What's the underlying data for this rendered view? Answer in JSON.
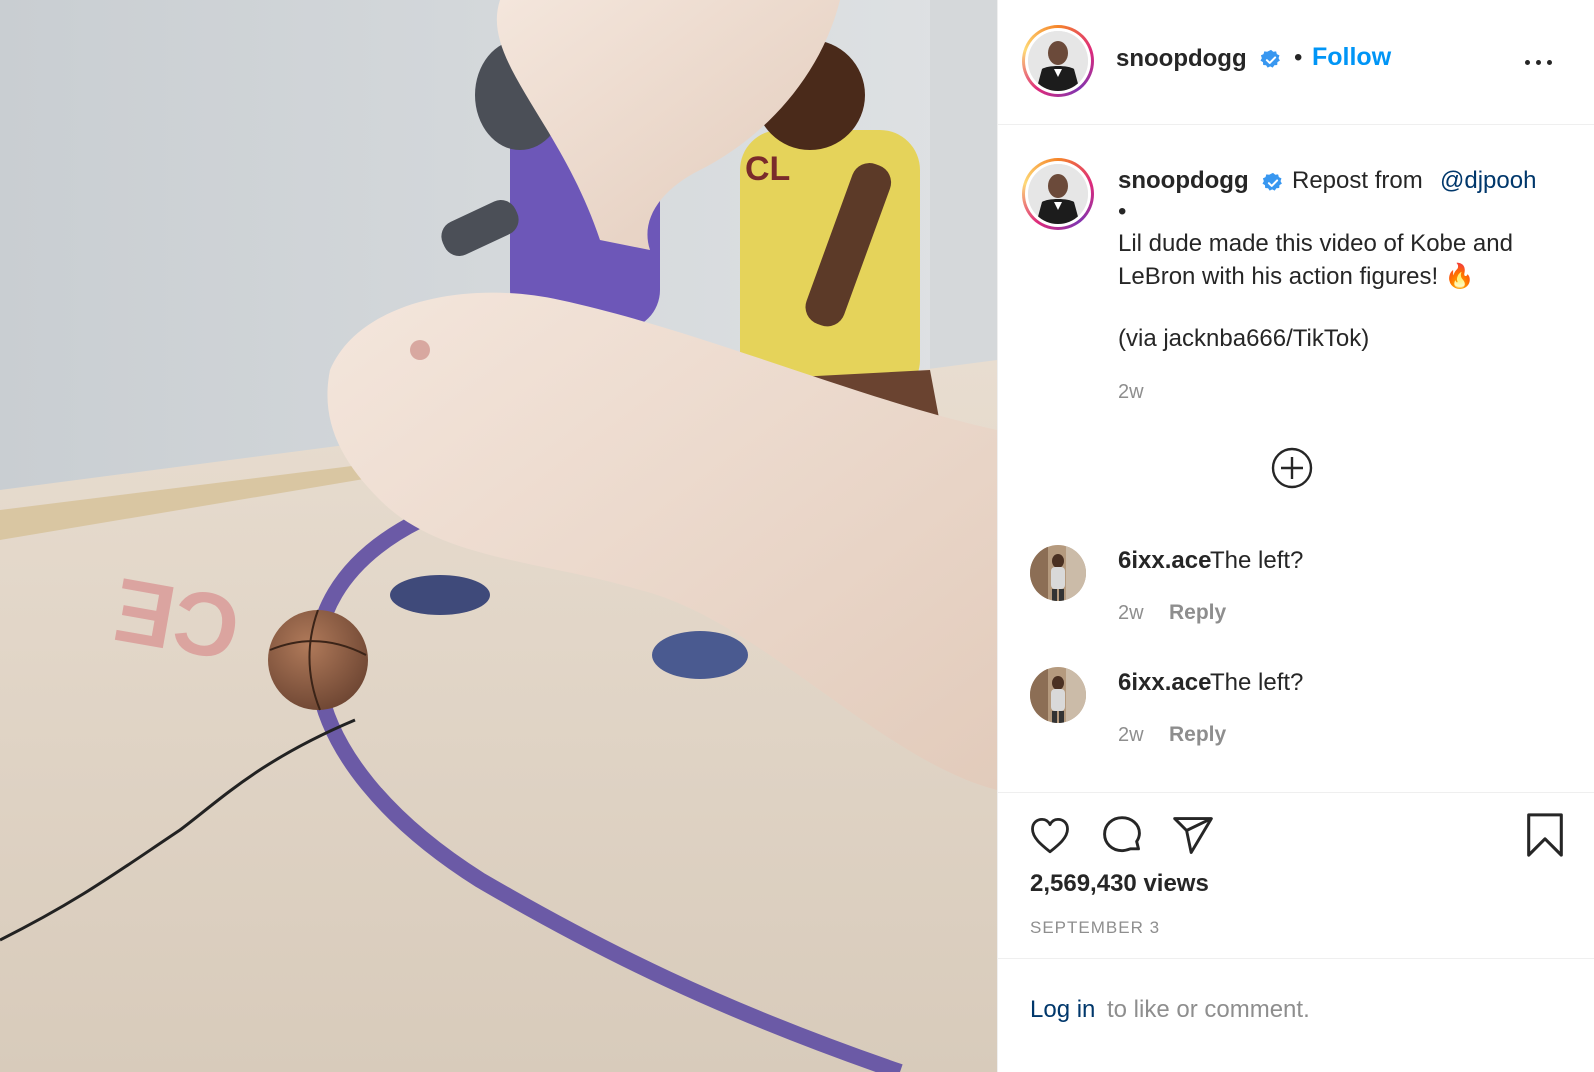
{
  "media": {
    "floor_text_1": "CE",
    "jersey_text": "CL"
  },
  "header": {
    "username": "snoopdogg",
    "separator": "•",
    "follow_label": "Follow"
  },
  "caption": {
    "username": "snoopdogg",
    "repost_text": "Repost from",
    "mention": "@djpooh",
    "bullet": "•",
    "line1": "Lil dude made this video of Kobe and",
    "line2": "LeBron with his action figures! 🔥",
    "line3": "(via jacknba666/TikTok)",
    "time": "2w"
  },
  "comments": [
    {
      "username": "6ixx.ace",
      "text": "The left?",
      "time": "2w",
      "reply_label": "Reply"
    },
    {
      "username": "6ixx.ace",
      "text": "The left?",
      "time": "2w",
      "reply_label": "Reply"
    }
  ],
  "stats": {
    "views": "2,569,430 views",
    "date": "SEPTEMBER 3"
  },
  "login": {
    "link": "Log in",
    "rest": "to like or comment."
  },
  "icons": {
    "verified": "verified-badge-icon",
    "more": "more-options-icon",
    "plus": "load-more-comments-icon",
    "like": "heart-icon",
    "comment": "comment-bubble-icon",
    "share": "paper-plane-icon",
    "save": "bookmark-icon"
  },
  "colors": {
    "follow": "#0095f6",
    "link": "#00376b",
    "muted": "#8e8e8e",
    "verified": "#3897f0"
  }
}
